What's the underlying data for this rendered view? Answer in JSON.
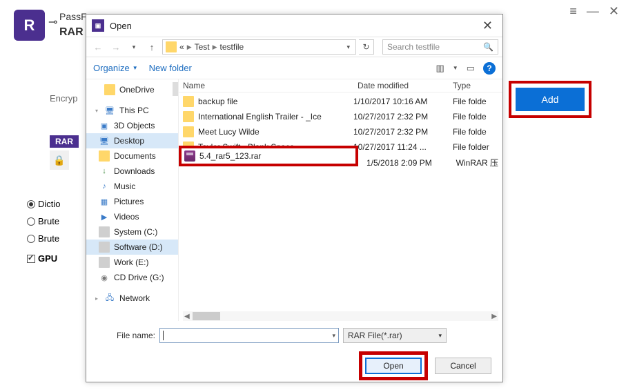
{
  "app": {
    "brand_letter": "R",
    "title_top": "PassF",
    "title_sub": "RAR",
    "menu_glyph": "≡",
    "min_glyph": "—",
    "close_glyph": "✕",
    "key_glyph": "⊸",
    "encrypt_label": "Encryp",
    "rar_badge": "RAR",
    "lock_glyph": "🔒",
    "radio_dict": "Dictio",
    "radio_brute1": "Brute",
    "radio_brute2": "Brute",
    "chk_gpu": "GPU",
    "add_btn": "Add"
  },
  "dlg": {
    "title": "Open",
    "close_glyph": "✕",
    "back_glyph": "←",
    "fwd_glyph": "→",
    "up_glyph": "↑",
    "breadcrumb": {
      "a": "«",
      "b": "Test",
      "c": "testfile"
    },
    "refresh_glyph": "↻",
    "search_placeholder": "Search testfile",
    "search_icon": "🔍",
    "organize": "Organize",
    "newfolder": "New folder",
    "view_icon": "▥",
    "preview_icon": "▭",
    "help_icon": "?",
    "tree": {
      "onedrive": "OneDrive",
      "thispc": "This PC",
      "items": [
        "3D Objects",
        "Desktop",
        "Documents",
        "Downloads",
        "Music",
        "Pictures",
        "Videos",
        "System (C:)",
        "Software (D:)",
        "Work (E:)",
        "CD Drive (G:)"
      ],
      "network": "Network"
    },
    "cols": {
      "name": "Name",
      "date": "Date modified",
      "type": "Type"
    },
    "rows": [
      {
        "name": "backup file",
        "date": "1/10/2017 10:16 AM",
        "type": "File folde",
        "kind": "folder"
      },
      {
        "name": "International English Trailer - _Ice",
        "date": "10/27/2017 2:32 PM",
        "type": "File folde",
        "kind": "folder"
      },
      {
        "name": "Meet Lucy Wilde",
        "date": "10/27/2017 2:32 PM",
        "type": "File folde",
        "kind": "folder"
      },
      {
        "name": "Taylor Swift - Blank Space",
        "date": "10/27/2017 11:24 ...",
        "type": "File folder",
        "kind": "folder"
      },
      {
        "name": "5.4_rar5_123.rar",
        "date": "1/5/2018 2:09 PM",
        "type": "WinRAR 压",
        "kind": "rar"
      }
    ],
    "fn_label": "File name:",
    "filter": "RAR File(*.rar)",
    "open": "Open",
    "cancel": "Cancel"
  }
}
